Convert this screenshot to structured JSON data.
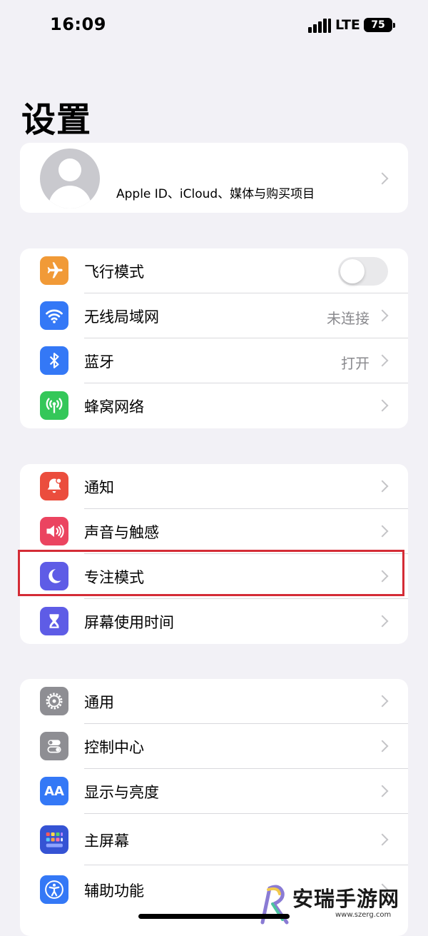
{
  "status_bar": {
    "time": "16:09",
    "network": "LTE",
    "battery": "75"
  },
  "title": "设置",
  "profile": {
    "subtitle": "Apple ID、iCloud、媒体与购买项目"
  },
  "groups": [
    {
      "rows": [
        {
          "label": "飞行模式",
          "icon": "airplane-icon",
          "color": "#f19a37",
          "toggle": false
        },
        {
          "label": "无线局域网",
          "icon": "wifi-icon",
          "color": "#3478f6",
          "value": "未连接"
        },
        {
          "label": "蓝牙",
          "icon": "bluetooth-icon",
          "color": "#3478f6",
          "value": "打开"
        },
        {
          "label": "蜂窝网络",
          "icon": "cellular-icon",
          "color": "#34c759"
        }
      ]
    },
    {
      "rows": [
        {
          "label": "通知",
          "icon": "notifications-icon",
          "color": "#eb4d3d"
        },
        {
          "label": "声音与触感",
          "icon": "sound-icon",
          "color": "#eb4460"
        },
        {
          "label": "专注模式",
          "icon": "moon-icon",
          "color": "#5e5ce6"
        },
        {
          "label": "屏幕使用时间",
          "icon": "hourglass-icon",
          "color": "#5e5ce6"
        }
      ]
    },
    {
      "rows": [
        {
          "label": "通用",
          "icon": "gear-icon",
          "color": "#8e8e93"
        },
        {
          "label": "控制中心",
          "icon": "control-center-icon",
          "color": "#8e8e93"
        },
        {
          "label": "显示与亮度",
          "icon": "display-icon",
          "color": "#3478f6",
          "glyph": "AA"
        },
        {
          "label": "主屏幕",
          "icon": "home-screen-icon",
          "color": "#3553d4"
        },
        {
          "label": "辅助功能",
          "icon": "accessibility-icon",
          "color": "#3478f6"
        }
      ]
    }
  ],
  "watermark": {
    "text": "安瑞手游网",
    "url": "www.szerg.com"
  }
}
